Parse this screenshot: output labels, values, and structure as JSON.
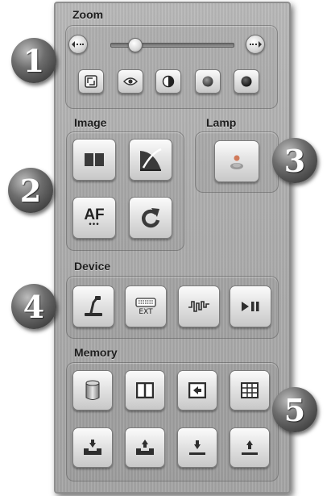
{
  "zoom": {
    "label": "Zoom",
    "zoom_out_icon": "zoom-out-arrows-icon",
    "zoom_in_icon": "zoom-in-arrows-icon",
    "slider_value": 0.2,
    "buttons": [
      "preview-icon",
      "eye-icon",
      "contrast-icon",
      "sphere-icon",
      "dark-sphere-icon"
    ]
  },
  "image": {
    "label": "Image",
    "af_label": "AF",
    "af_dots": "•••",
    "buttons": [
      "split-icon",
      "curve-icon",
      "autofocus-icon",
      "rotate-icon"
    ]
  },
  "lamp": {
    "label": "Lamp",
    "button_icon": "lamp-icon"
  },
  "device": {
    "label": "Device",
    "ext_label": "EXT",
    "buttons": [
      "camera-arm-icon",
      "keyboard-ext-icon",
      "signal-icon",
      "play-pause-icon"
    ]
  },
  "memory": {
    "label": "Memory",
    "buttons": [
      "cylinder-icon",
      "dual-pane-icon",
      "import-icon",
      "grid-icon",
      "download-tray-icon",
      "upload-tray-icon",
      "download-icon",
      "upload-icon"
    ]
  },
  "badges": [
    "1",
    "2",
    "3",
    "4",
    "5"
  ],
  "colors": {
    "panel": "#acacac",
    "badge": "#4a4a4a",
    "button_face": "#dedede",
    "icon_dark": "#3a3a3a"
  }
}
